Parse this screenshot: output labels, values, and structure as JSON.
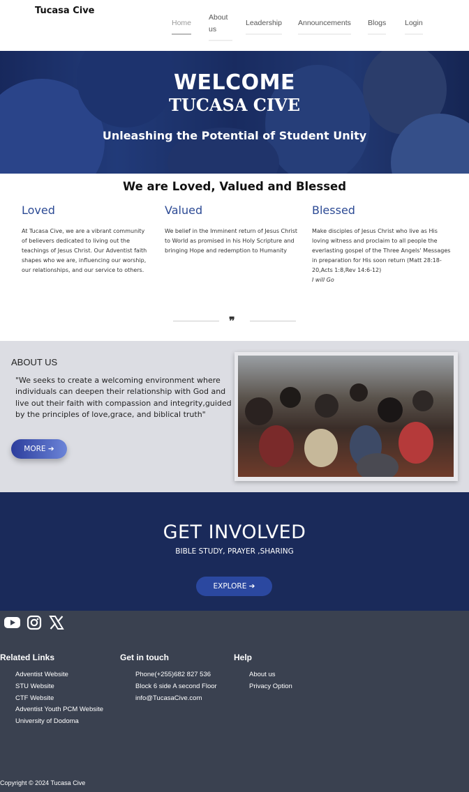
{
  "brand": "Tucasa Cive",
  "nav": {
    "items": [
      {
        "label": "Home",
        "active": true
      },
      {
        "label": "About us"
      },
      {
        "label": "Leadership"
      },
      {
        "label": "Announcements"
      },
      {
        "label": "Blogs"
      },
      {
        "label": "Login"
      }
    ]
  },
  "hero": {
    "welcome": "WELCOME",
    "name": "TUCASA CIVE",
    "tagline": "Unleashing the Potential of Student Unity"
  },
  "values": {
    "title": "We are Loved, Valued and Blessed",
    "columns": [
      {
        "heading": "Loved",
        "text": "At Tucasa Cive, we are a vibrant community of believers dedicated to living out the teachings of Jesus Christ. Our Adventist faith shapes who we are, influencing our worship, our relationships, and our service to others."
      },
      {
        "heading": "Valued",
        "text": "We belief in the Imminent return of Jesus Christ to World as promised in his Holy Scripture and bringing Hope and redemption to Humanity"
      },
      {
        "heading": "Blessed",
        "text": "Make disciples of Jesus Christ who live as His loving witness and proclaim to all people the everlasting gospel of the Three Angels' Messages in preparation for His soon return (Matt 28:18-20,Acts 1:8,Rev 14:6-12)",
        "italic": "I will Go"
      }
    ],
    "quote_mark": "❞"
  },
  "about": {
    "title": "ABOUT US",
    "text": "\"We seeks to create a welcoming environment where individuals can deepen their relationship with God and live out their faith with compassion and integrity,guided by the principles of love,grace, and biblical truth\"",
    "button": "MORE ➔"
  },
  "involved": {
    "title": "GET INVOLVED",
    "subtitle": "BIBLE STUDY, PRAYER ,SHARING",
    "button": "EXPLORE ➔"
  },
  "footer": {
    "social": [
      "youtube-icon",
      "instagram-icon",
      "x-icon"
    ],
    "related": {
      "title": "Related Links",
      "items": [
        "Adventist Website",
        "STU Website",
        "CTF Website",
        "Adventist Youth PCM Website",
        "University of Dodoma"
      ]
    },
    "contact": {
      "title": "Get in touch",
      "items": [
        "Phone(+255)682 827 536",
        "Block 6 side A second Floor",
        "info@TucasaCive.com"
      ]
    },
    "help": {
      "title": "Help",
      "items": [
        "About us",
        "Privacy Option"
      ]
    },
    "copyright": "Copyright © 2024 Tucasa Cive"
  },
  "colors": {
    "accent": "#2c4a94",
    "involved_bg": "#1a2a5a",
    "footer_bg": "#3a4150",
    "about_bg": "#dcdde3"
  }
}
